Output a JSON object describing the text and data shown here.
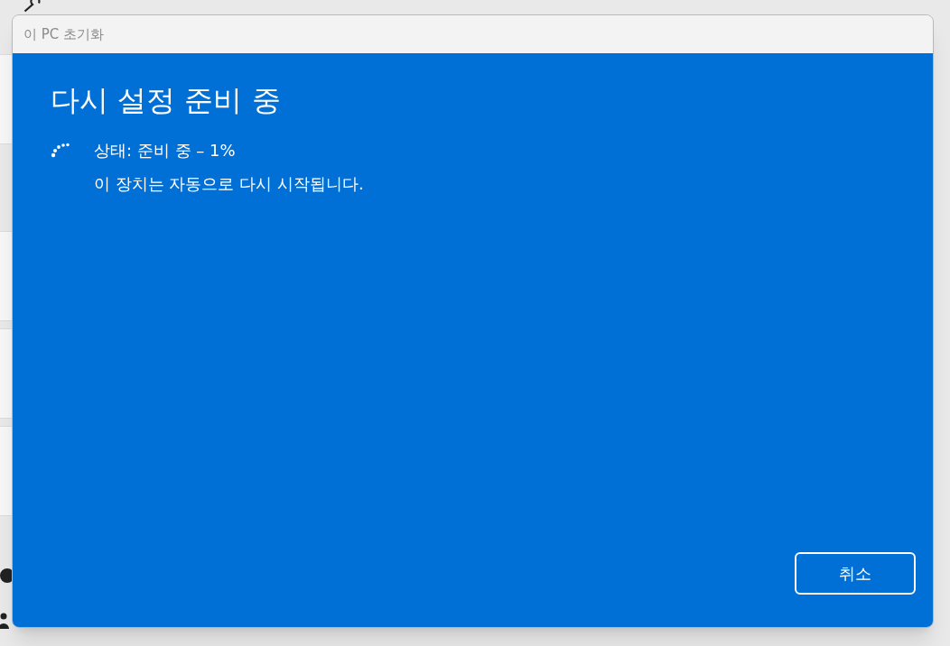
{
  "dialog": {
    "title": "이 PC 초기화",
    "heading": "다시 설정 준비 중",
    "status": "상태: 준비 중 – 1%",
    "message": "이 장치는 자동으로 다시 시작됩니다.",
    "buttons": [
      {
        "label": "취소",
        "kind": "outline"
      }
    ]
  }
}
